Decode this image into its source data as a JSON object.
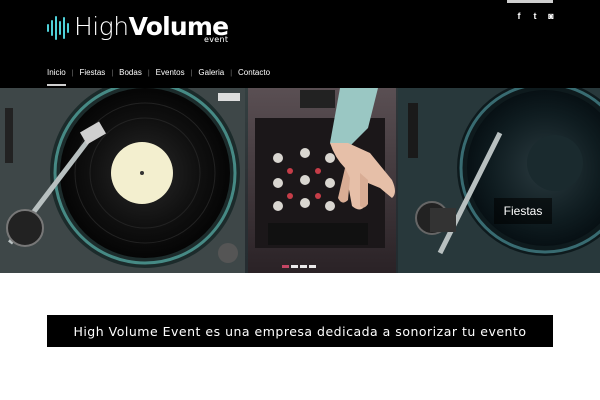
{
  "brand": {
    "name_light": "High",
    "name_bold": "Volume",
    "subtitle": "event",
    "accent_color": "#4fd1d9"
  },
  "social": [
    {
      "icon": "facebook-icon",
      "glyph": "f"
    },
    {
      "icon": "twitter-icon",
      "glyph": "t"
    },
    {
      "icon": "instagram-icon",
      "glyph": "◙"
    }
  ],
  "nav": {
    "items": [
      {
        "label": "Inicio",
        "active": true
      },
      {
        "label": "Fiestas"
      },
      {
        "label": "Bodas"
      },
      {
        "label": "Eventos"
      },
      {
        "label": "Galeria"
      },
      {
        "label": "Contacto"
      }
    ]
  },
  "hero": {
    "caption": "Fiestas",
    "active_slide_color": "#d54a6b"
  },
  "banner": {
    "text": "High Volume Event es una empresa dedicada a sonorizar tu evento"
  }
}
